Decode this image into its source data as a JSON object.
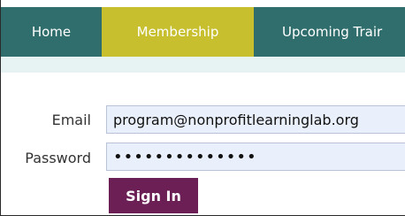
{
  "nav": {
    "items": [
      {
        "label": "Home"
      },
      {
        "label": "Membership",
        "active": true
      },
      {
        "label": "Upcoming Trair"
      }
    ]
  },
  "form": {
    "email_label": "Email",
    "email_value": "program@nonprofitlearninglab.org",
    "password_label": "Password",
    "password_value": "••••••••••••••",
    "submit_label": "Sign In"
  },
  "colors": {
    "nav_background": "#2f6e6d",
    "nav_active": "#c7bf2e",
    "button": "#6b1f55",
    "subbar": "#e7f3f3"
  }
}
